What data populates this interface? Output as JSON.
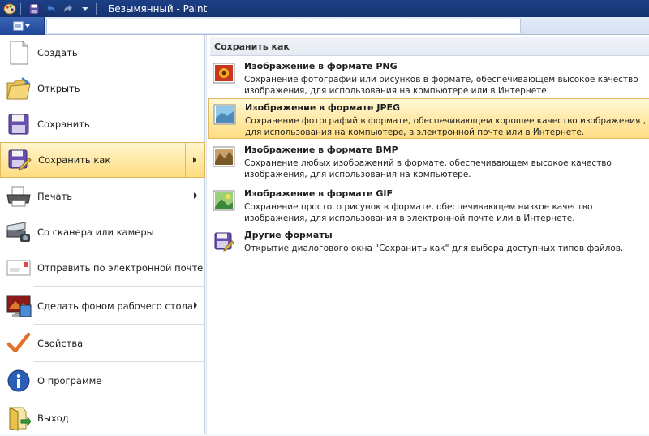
{
  "window": {
    "title": "Безымянный - Paint"
  },
  "menu": {
    "items": [
      {
        "label": "Создать",
        "icon": "new-document-icon"
      },
      {
        "label": "Открыть",
        "icon": "open-folder-icon"
      },
      {
        "label": "Сохранить",
        "icon": "save-icon"
      },
      {
        "label": "Сохранить как",
        "icon": "save-as-icon",
        "active": true,
        "submenu": true
      },
      {
        "label": "Печать",
        "icon": "printer-icon",
        "submenu": true
      },
      {
        "label": "Со сканера или камеры",
        "icon": "scanner-icon"
      },
      {
        "label": "Отправить по электронной почте",
        "icon": "email-icon"
      },
      {
        "label": "Сделать фоном рабочего стола",
        "icon": "desktop-background-icon",
        "submenu": true
      },
      {
        "label": "Свойства",
        "icon": "properties-checkmark-icon"
      },
      {
        "label": "О программе",
        "icon": "info-icon"
      },
      {
        "label": "Выход",
        "icon": "exit-icon"
      }
    ]
  },
  "submenu": {
    "header": "Сохранить как",
    "formats": [
      {
        "title": "Изображение в формате PNG",
        "desc": "Сохранение фотографий или рисунков в формате, обеспечивающем высокое качество изображения, для использования на компьютере или в Интернете.",
        "icon": "png-image-icon"
      },
      {
        "title": "Изображение в формате JPEG",
        "desc": "Сохранение фотографий в формате, обеспечивающем хорошее качество изображения , для использования на компьютере, в электронной почте или в Интернете.",
        "icon": "jpeg-image-icon",
        "active": true
      },
      {
        "title": "Изображение в формате BMP",
        "desc": "Сохранение любых изображений в формате, обеспечивающем высокое качество изображения, для использования на компьютере.",
        "icon": "bmp-image-icon"
      },
      {
        "title": "Изображение в формате GIF",
        "desc": "Сохранение простого рисунок в формате, обеспечивающем низкое качество изображения, для использования в электронной почте или в Интернете.",
        "icon": "gif-image-icon"
      },
      {
        "title": "Другие форматы",
        "desc": "Открытие диалогового окна \"Сохранить как\" для выбора доступных типов файлов.",
        "icon": "other-formats-icon"
      }
    ]
  },
  "colors": {
    "titlebar": "#15336f",
    "highlight": "#ffe9a6",
    "highlight_border": "#e1b95a"
  }
}
